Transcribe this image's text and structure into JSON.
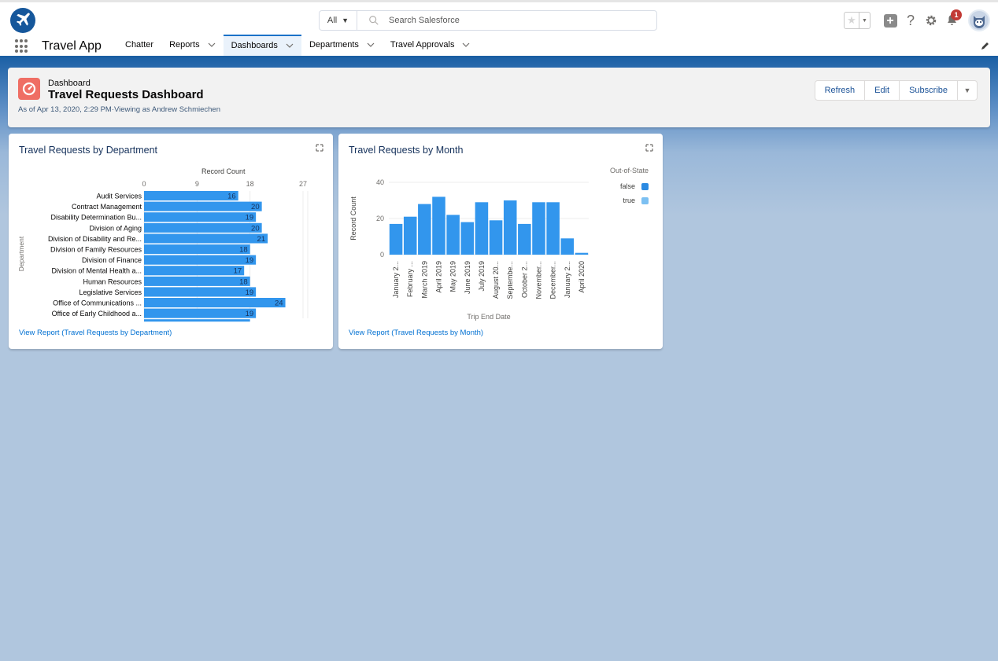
{
  "global_header": {
    "logo_icon": "airplane-icon",
    "search_scope": "All",
    "search_placeholder": "Search Salesforce",
    "notification_count": "1",
    "icons": [
      "favorite-star-icon",
      "favorites-dropdown-icon",
      "global-add-icon",
      "help-icon",
      "setup-gear-icon",
      "notifications-bell-icon",
      "user-avatar"
    ]
  },
  "app_nav": {
    "app_name": "Travel App",
    "items": [
      {
        "label": "Chatter",
        "has_menu": false,
        "active": false
      },
      {
        "label": "Reports",
        "has_menu": true,
        "active": false
      },
      {
        "label": "Dashboards",
        "has_menu": true,
        "active": true
      },
      {
        "label": "Departments",
        "has_menu": true,
        "active": false
      },
      {
        "label": "Travel Approvals",
        "has_menu": true,
        "active": false
      }
    ]
  },
  "page_header": {
    "eyebrow": "Dashboard",
    "title": "Travel Requests Dashboard",
    "meta": "As of Apr 13, 2020, 2:29 PM·Viewing as Andrew Schmiechen",
    "buttons": {
      "refresh": "Refresh",
      "edit": "Edit",
      "subscribe": "Subscribe"
    }
  },
  "widgets": {
    "by_department": {
      "title": "Travel Requests by Department",
      "view_report": "View Report (Travel Requests by Department)"
    },
    "by_month": {
      "title": "Travel Requests by Month",
      "view_report": "View Report (Travel Requests by Month)"
    }
  },
  "colors": {
    "bar": "#3296ed",
    "legend_false": "#2b8ae2",
    "legend_true": "#7cc0f2",
    "link": "#0070d2",
    "brand": "#1b5fa3"
  },
  "chart_data": [
    {
      "type": "bar",
      "orientation": "horizontal",
      "title": "Travel Requests by Department",
      "xlabel": "Record Count",
      "ylabel": "Department",
      "xlim": [
        0,
        27
      ],
      "xticks": [
        0,
        9,
        18,
        27
      ],
      "grid": true,
      "categories": [
        "Audit Services",
        "Contract Management",
        "Disability Determination Bu...",
        "Division of Aging",
        "Division of Disability and Re...",
        "Division of Family Resources",
        "Division of Finance",
        "Division of Mental Health a...",
        "Human Resources",
        "Legislative Services",
        "Office of Communications ...",
        "Office of Early Childhood a...",
        ""
      ],
      "values": [
        16,
        20,
        19,
        20,
        21,
        18,
        19,
        17,
        18,
        19,
        24,
        19,
        18
      ],
      "data_labels": [
        "16",
        "20",
        "19",
        "20",
        "21",
        "18",
        "19",
        "17",
        "18",
        "19",
        "24",
        "19",
        ""
      ]
    },
    {
      "type": "bar",
      "orientation": "vertical",
      "title": "Travel Requests by Month",
      "xlabel": "Trip End Date",
      "ylabel": "Record Count",
      "ylim": [
        0,
        40
      ],
      "yticks": [
        0,
        20,
        40
      ],
      "grid": true,
      "legend": {
        "title": "Out-of-State",
        "entries": [
          "false",
          "true"
        ],
        "placement": "right"
      },
      "categories": [
        "January 2...",
        "February ...",
        "March 2019",
        "April 2019",
        "May 2019",
        "June 2019",
        "July 2019",
        "August 20...",
        "Septembe...",
        "October 2...",
        "November...",
        "December...",
        "January 2...",
        "April 2020"
      ],
      "series": [
        {
          "name": "false",
          "values": [
            17,
            21,
            28,
            32,
            22,
            18,
            29,
            19,
            30,
            17,
            29,
            29,
            9,
            1
          ]
        },
        {
          "name": "true",
          "values": [
            0,
            0,
            0,
            0,
            0,
            0,
            0,
            0,
            0,
            0,
            0,
            0,
            0,
            0
          ]
        }
      ]
    }
  ]
}
